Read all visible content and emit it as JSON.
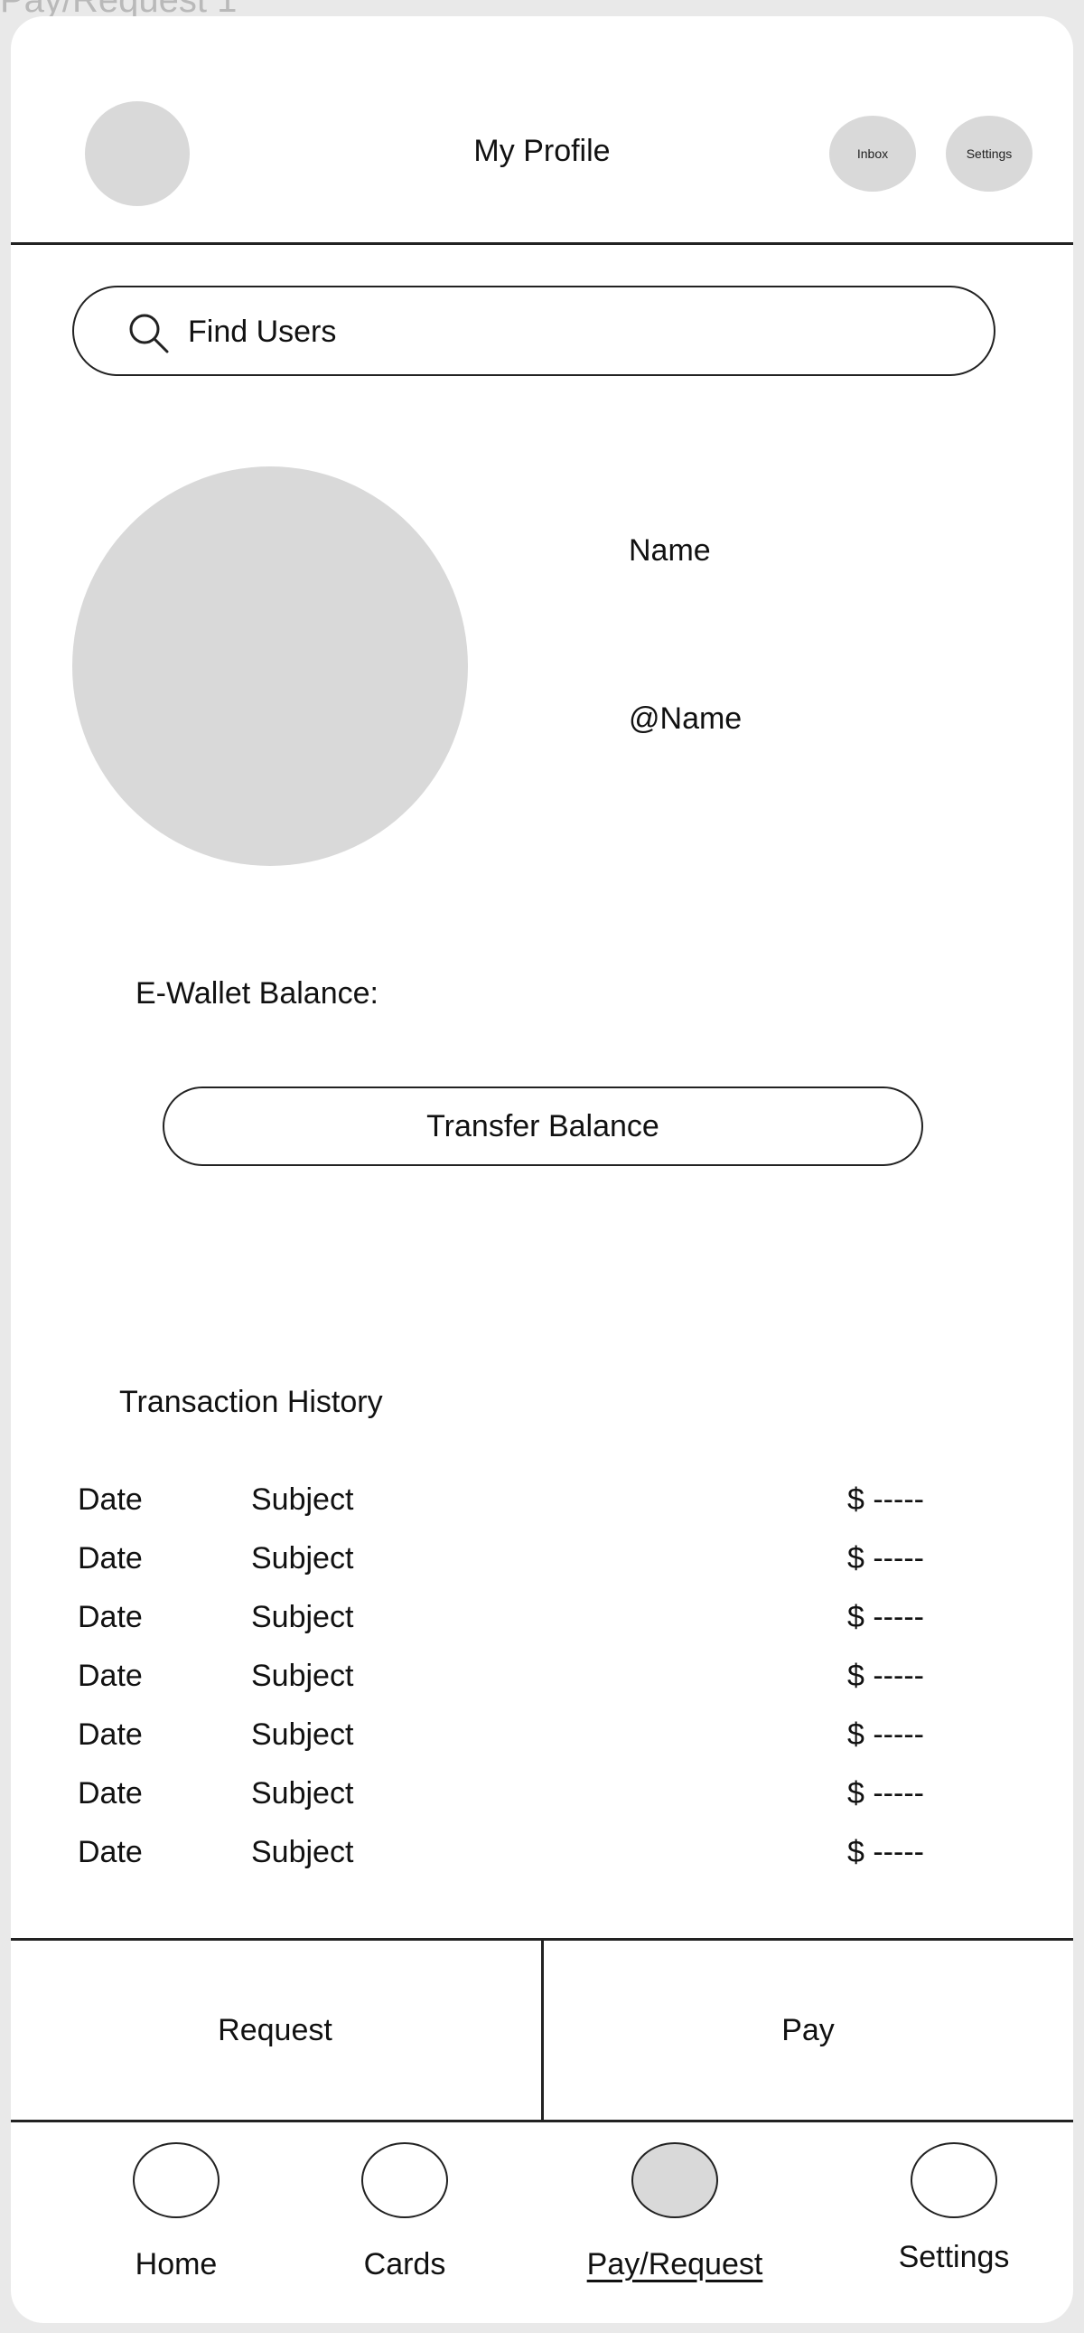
{
  "frame_title": "Pay/Request 1",
  "header": {
    "title": "My Profile",
    "inbox_label": "Inbox",
    "settings_label": "Settings"
  },
  "search": {
    "placeholder": "Find Users"
  },
  "profile": {
    "name": "Name",
    "handle": "@Name"
  },
  "wallet": {
    "balance_label": "E-Wallet Balance:",
    "transfer_label": "Transfer Balance"
  },
  "transactions": {
    "heading": "Transaction History",
    "rows": [
      {
        "date": "Date",
        "subject": "Subject",
        "amount": "$ -----"
      },
      {
        "date": "Date",
        "subject": "Subject",
        "amount": "$ -----"
      },
      {
        "date": "Date",
        "subject": "Subject",
        "amount": "$ -----"
      },
      {
        "date": "Date",
        "subject": "Subject",
        "amount": "$ -----"
      },
      {
        "date": "Date",
        "subject": "Subject",
        "amount": "$ -----"
      },
      {
        "date": "Date",
        "subject": "Subject",
        "amount": "$ -----"
      },
      {
        "date": "Date",
        "subject": "Subject",
        "amount": "$ -----"
      }
    ]
  },
  "actions": {
    "request_label": "Request",
    "pay_label": "Pay"
  },
  "nav": {
    "items": [
      {
        "label": "Home"
      },
      {
        "label": "Cards"
      },
      {
        "label": "Pay/Request"
      },
      {
        "label": "Settings"
      }
    ],
    "active": "Pay/Request"
  },
  "colors": {
    "placeholder_gray": "#d9d9d9",
    "stroke": "#222222",
    "background": "#e9e9e9"
  }
}
